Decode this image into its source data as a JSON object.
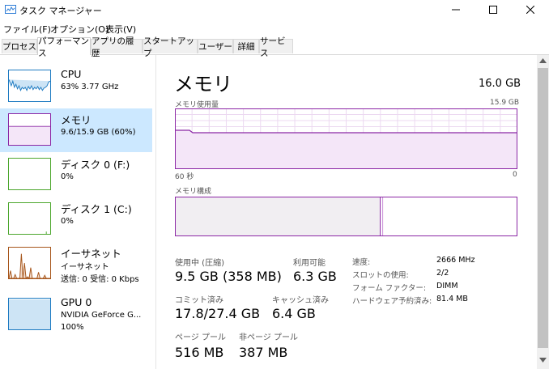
{
  "window": {
    "title": "タスク マネージャー"
  },
  "menu": [
    "ファイル(F)",
    "オプション(O)",
    "表示(V)"
  ],
  "tabs": [
    {
      "label": "プロセス",
      "active": false
    },
    {
      "label": "パフォーマンス",
      "active": true
    },
    {
      "label": "アプリの履歴",
      "active": false
    },
    {
      "label": "スタートアップ",
      "active": false
    },
    {
      "label": "ユーザー",
      "active": false
    },
    {
      "label": "詳細",
      "active": false
    },
    {
      "label": "サービス",
      "active": false
    }
  ],
  "sidebar": {
    "items": [
      {
        "title": "CPU",
        "sub1": "63%  3.77 GHz",
        "sub2": "",
        "sub3": "",
        "color": "#1e7bc2",
        "selected": false
      },
      {
        "title": "メモリ",
        "sub1": "9.6/15.9 GB (60%)",
        "sub2": "",
        "sub3": "",
        "color": "#8b27a5",
        "selected": true
      },
      {
        "title": "ディスク 0 (F:)",
        "sub1": "0%",
        "sub2": "",
        "sub3": "",
        "color": "#4da72e",
        "selected": false
      },
      {
        "title": "ディスク 1 (C:)",
        "sub1": "0%",
        "sub2": "",
        "sub3": "",
        "color": "#4da72e",
        "selected": false
      },
      {
        "title": "イーサネット",
        "sub1": "イーサネット",
        "sub2": "送信: 0 受信: 0 Kbps",
        "sub3": "",
        "color": "#a7561b",
        "selected": false
      },
      {
        "title": "GPU 0",
        "sub1": "NVIDIA GeForce G...",
        "sub2": "100%",
        "sub3": "",
        "color": "#1e7bc2",
        "selected": false
      }
    ]
  },
  "main": {
    "title": "メモリ",
    "total": "16.0 GB",
    "usage_graph": {
      "label": "メモリ使用量",
      "max_label": "15.9 GB",
      "left_axis": "60 秒",
      "right_axis": "0",
      "current_fraction": 0.6
    },
    "composition": {
      "label": "メモリ構成",
      "in_use_fraction": 0.6
    },
    "stats": {
      "in_use_label": "使用中 (圧縮)",
      "in_use_value": "9.5 GB (358 MB)",
      "available_label": "利用可能",
      "available_value": "6.3 GB",
      "committed_label": "コミット済み",
      "committed_value": "17.8/27.4 GB",
      "cached_label": "キャッシュ済み",
      "cached_value": "6.4 GB",
      "paged_label": "ページ プール",
      "paged_value": "516 MB",
      "nonpaged_label": "非ページ プール",
      "nonpaged_value": "387 MB"
    },
    "details": [
      {
        "label": "速度:",
        "value": "2666 MHz"
      },
      {
        "label": "スロットの使用:",
        "value": "2/2"
      },
      {
        "label": "フォーム ファクター:",
        "value": "DIMM"
      },
      {
        "label": "ハードウェア予約済み:",
        "value": "81.4 MB"
      }
    ]
  },
  "colors": {
    "memory": "#8b27a5",
    "cpu": "#1e7bc2",
    "disk": "#4da72e",
    "ethernet": "#a7561b",
    "selected_bg": "#cce8ff"
  }
}
